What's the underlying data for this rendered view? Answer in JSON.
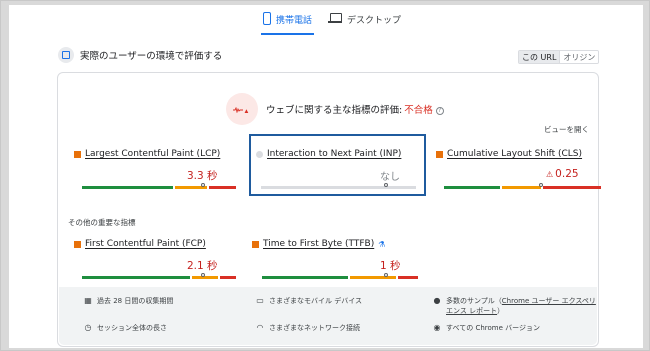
{
  "tabs": [
    {
      "label": "携帯電話",
      "active": true,
      "icon": "phone-icon"
    },
    {
      "label": "デスクトップ",
      "active": false,
      "icon": "laptop-icon"
    }
  ],
  "header": {
    "title": "実際のユーザーの環境で評価する",
    "url_toggle": {
      "on": "この URL",
      "off": "オリジン"
    }
  },
  "assessment": {
    "label": "ウェブに関する主な指標の評価:",
    "status": "不合格",
    "status_color": "#d93025",
    "expand_label": "ビューを開く"
  },
  "metrics": {
    "lcp": {
      "name": "Largest Contentful Paint (LCP)",
      "value": "3.3 秒",
      "status": "needs-improvement"
    },
    "inp": {
      "name": "Interaction to Next Paint (INP)",
      "value": "なし",
      "status": "none"
    },
    "cls": {
      "name": "Cumulative Layout Shift (CLS)",
      "value": "0.25",
      "status": "poor"
    },
    "fcp": {
      "name": "First Contentful Paint (FCP)",
      "value": "2.1 秒",
      "status": "needs-improvement"
    },
    "ttfb": {
      "name": "Time to First Byte (TTFB)",
      "value": "1 秒",
      "status": "needs-improvement"
    }
  },
  "other_metrics_label": "その他の重要な指標",
  "footer": {
    "period": "過去 28 日間の収集期間",
    "devices": "さまざまなモバイル デバイス",
    "samples_prefix": "多数のサンプル（",
    "samples_link": "Chrome ユーザー エクスペリエンス レポート",
    "samples_suffix": "）",
    "session": "セッション全体の長さ",
    "network": "さまざまなネットワーク接続",
    "chrome": "すべての Chrome バージョン"
  },
  "colors": {
    "good": "#1e8e3e",
    "needs_improvement": "#f29900",
    "poor": "#d93025",
    "accent": "#1a73e8"
  }
}
